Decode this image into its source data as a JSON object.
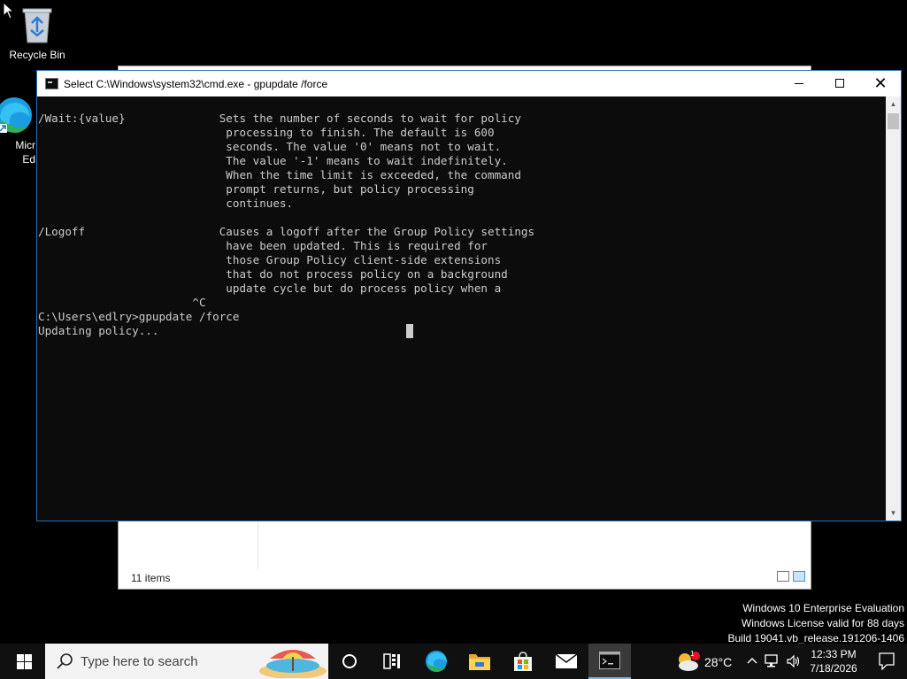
{
  "desktop": {
    "icons": [
      {
        "label": "Recycle Bin"
      },
      {
        "label": "Micr\nEd"
      }
    ]
  },
  "explorer": {
    "status_items": "11 items"
  },
  "cmd": {
    "title": "Select C:\\Windows\\system32\\cmd.exe - gpupdate  /force",
    "lines": [
      "/Wait:{value}              Sets the number of seconds to wait for policy",
      "                            processing to finish. The default is 600",
      "                            seconds. The value '0' means not to wait.",
      "                            The value '-1' means to wait indefinitely.",
      "                            When the time limit is exceeded, the command",
      "                            prompt returns, but policy processing",
      "                            continues.",
      "",
      "/Logoff                    Causes a logoff after the Group Policy settings",
      "                            have been updated. This is required for",
      "                            those Group Policy client-side extensions",
      "                            that do not process policy on a background",
      "                            update cycle but do process policy when a",
      "                       ^C",
      "C:\\Users\\edlry>gpupdate /force",
      "Updating policy..."
    ]
  },
  "watermark": {
    "line1": "Windows 10 Enterprise Evaluation",
    "line2": "Windows License valid for 88 days",
    "line3": "Build 19041.vb_release.191206-1406"
  },
  "taskbar": {
    "search_placeholder": "Type here to search",
    "weather_temp": "28°C",
    "weather_badge": "1",
    "time": "12:33 PM",
    "date": "7/18/2026"
  },
  "colors": {
    "console_bg": "#0c0c0c",
    "console_fg": "#cccccc",
    "taskbar_bg": "#101010",
    "accent": "#76b9ed"
  }
}
